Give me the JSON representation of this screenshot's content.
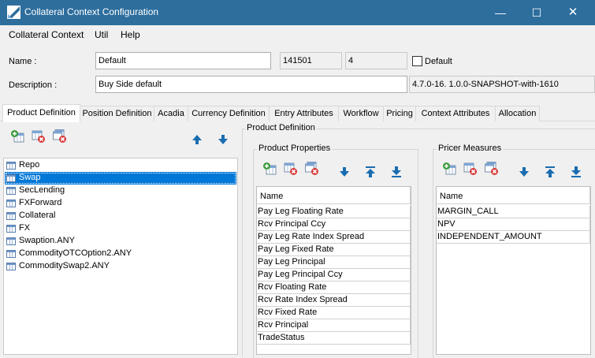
{
  "window": {
    "title": "Collateral Context Configuration",
    "minimize": "—",
    "maximize": "☐",
    "close": "✕"
  },
  "menu": [
    "Collateral Context",
    "Util",
    "Help"
  ],
  "form": {
    "name_label": "Name :",
    "name_value": "Default",
    "id_value": "141501",
    "version_value": "4",
    "default_checkbox_label": "Default",
    "default_checked": false,
    "description_label": "Description :",
    "description_value": "Buy Side default",
    "build_value": "4.7.0-16. 1.0.0-SNAPSHOT-with-1610"
  },
  "tabs": [
    "Product Definition",
    "Position Definition",
    "Acadia",
    "Currency Definition",
    "Entry Attributes",
    "Workflow",
    "Pricing",
    "Context Attributes",
    "Allocation"
  ],
  "active_tab": "Product Definition",
  "products": {
    "items": [
      "Repo",
      "Swap",
      "SecLending",
      "FXForward",
      "Collateral",
      "FX",
      "Swaption.ANY",
      "CommodityOTCOption2.ANY",
      "CommoditySwap2.ANY"
    ],
    "selected": "Swap"
  },
  "product_definition": {
    "title": "Product Definition",
    "product_properties": {
      "title": "Product Properties",
      "column": "Name",
      "rows": [
        "Pay Leg Floating Rate",
        "Rcv Principal Ccy",
        "Pay Leg Rate Index Spread",
        "Pay Leg Fixed Rate",
        "Pay Leg Principal",
        "Pay Leg Principal Ccy",
        "Rcv Floating Rate",
        "Rcv Rate Index Spread",
        "Rcv Fixed Rate",
        "Rcv Principal",
        "TradeStatus"
      ]
    },
    "pricer_measures": {
      "title": "Pricer Measures",
      "column": "Name",
      "rows": [
        "MARGIN_CALL",
        "NPV",
        "INDEPENDENT_AMOUNT"
      ]
    }
  },
  "colors": {
    "titlebar": "#2d6e9d",
    "selection": "#0078d7",
    "add_icon": "#3a9a3a",
    "remove_icon": "#d93b3b",
    "arrow_icon": "#1a6cb0"
  },
  "icons": [
    "add-icon",
    "remove-icon",
    "remove-all-icon",
    "move-up-icon",
    "move-down-icon",
    "move-top-icon",
    "move-bottom-icon"
  ]
}
